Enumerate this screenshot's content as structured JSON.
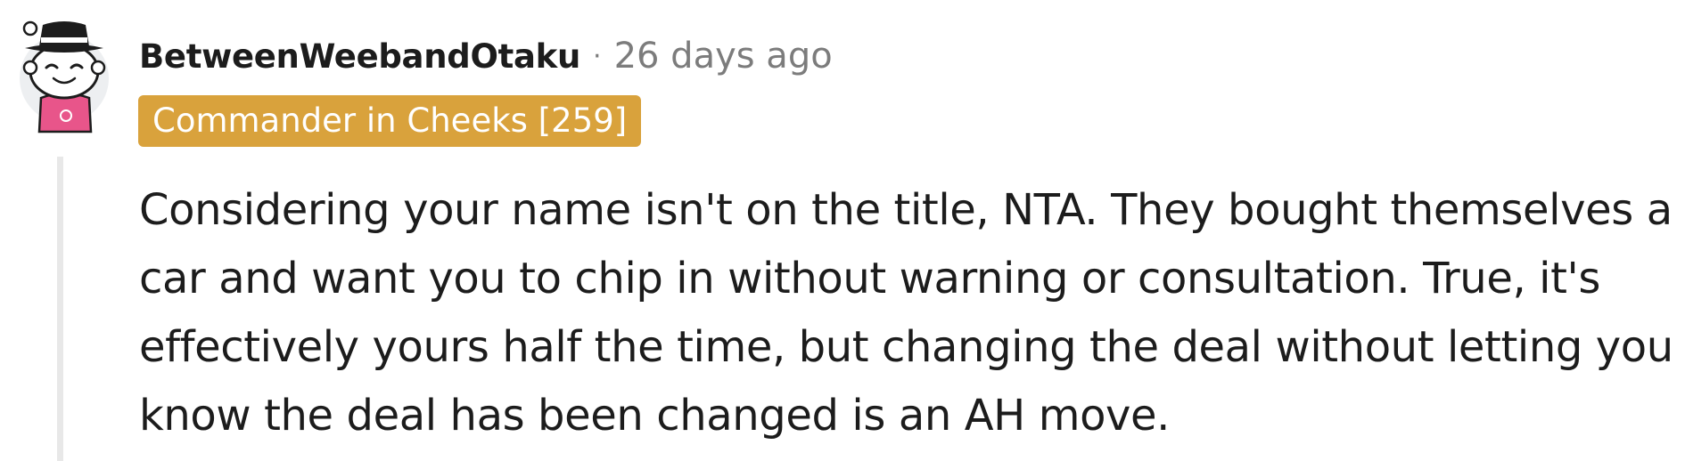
{
  "comment": {
    "username": "BetweenWeebandOtaku",
    "separator": "·",
    "timestamp": "26 days ago",
    "flair": "Commander in Cheeks [259]",
    "body": "Considering your name isn't on the title, NTA. They bought themselves a car and want you to chip in without warning or consultation. True, it's effectively yours half the time, but changing the deal without letting you know the deal has been changed is an AH move."
  },
  "colors": {
    "flair_background": "#d9a23c",
    "flair_text": "#ffffff",
    "username": "#1c1c1c",
    "meta": "#7c7c7c",
    "thread_line": "#e8e8e8",
    "avatar_shirt": "#e8558a"
  },
  "icons": {
    "avatar": "snoo-avatar-with-fedora-icon"
  }
}
